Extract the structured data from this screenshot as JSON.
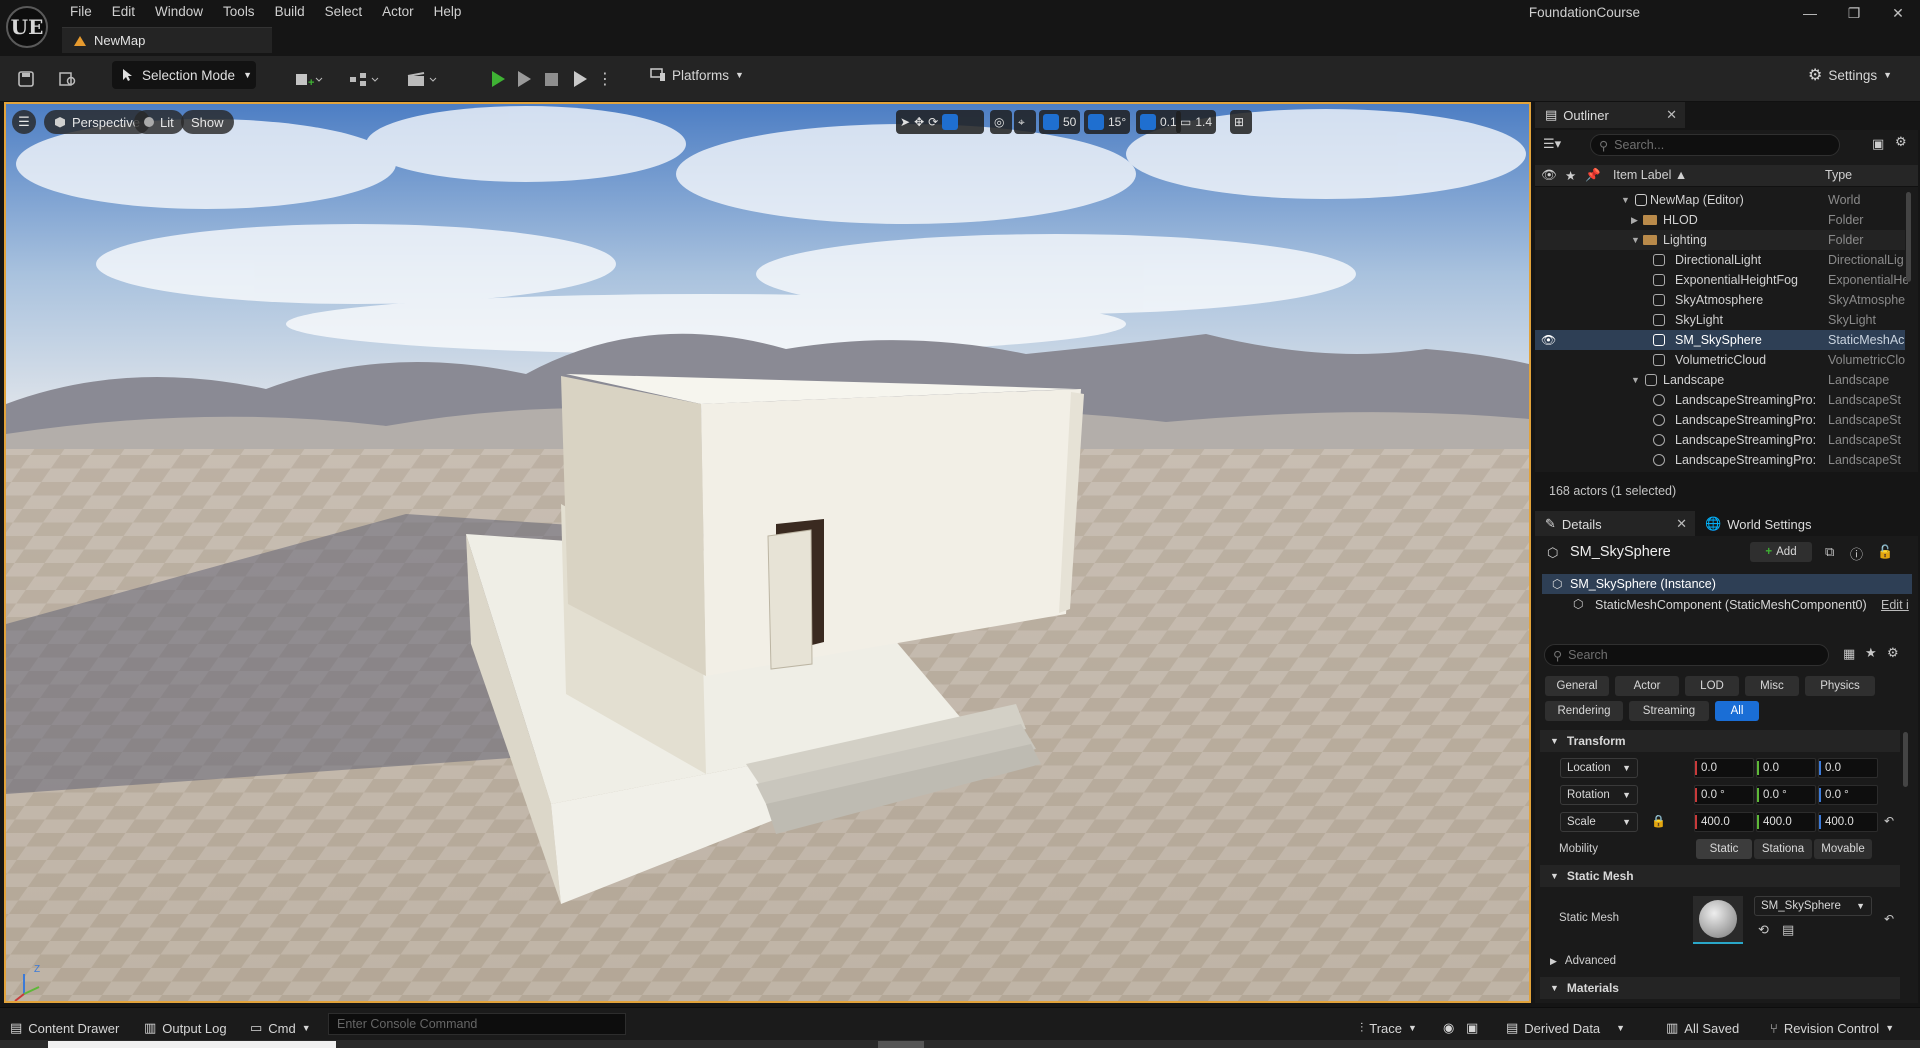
{
  "titlebar": {
    "logo": "UE",
    "menu": [
      "File",
      "Edit",
      "Window",
      "Tools",
      "Build",
      "Select",
      "Actor",
      "Help"
    ],
    "project": "FoundationCourse",
    "tab": "NewMap"
  },
  "toolbar": {
    "selection_mode": "Selection Mode",
    "platforms": "Platforms",
    "settings": "Settings"
  },
  "viewport": {
    "view_mode": "Perspective",
    "lighting": "Lit",
    "show": "Show",
    "grid_snap": "50",
    "rot_snap": "15°",
    "scale_snap": "0.1",
    "cam_speed": "1.4",
    "axis_label": "Z"
  },
  "outliner": {
    "title": "Outliner",
    "search_placeholder": "Search...",
    "col_label": "Item Label ▲",
    "col_type": "Type",
    "rows": [
      {
        "label": "NewMap (Editor)",
        "type": "World"
      },
      {
        "label": "HLOD",
        "type": "Folder"
      },
      {
        "label": "Lighting",
        "type": "Folder"
      },
      {
        "label": "DirectionalLight",
        "type": "DirectionalLig"
      },
      {
        "label": "ExponentialHeightFog",
        "type": "ExponentialHe"
      },
      {
        "label": "SkyAtmosphere",
        "type": "SkyAtmosphe"
      },
      {
        "label": "SkyLight",
        "type": "SkyLight"
      },
      {
        "label": "SM_SkySphere",
        "type": "StaticMeshAc"
      },
      {
        "label": "VolumetricCloud",
        "type": "VolumetricClo"
      },
      {
        "label": "Landscape",
        "type": "Landscape"
      },
      {
        "label": "LandscapeStreamingPro:",
        "type": "LandscapeSt"
      },
      {
        "label": "LandscapeStreamingPro:",
        "type": "LandscapeSt"
      },
      {
        "label": "LandscapeStreamingPro:",
        "type": "LandscapeSt"
      },
      {
        "label": "LandscapeStreamingPro:",
        "type": "LandscapeSt"
      }
    ],
    "footer": "168 actors (1 selected)"
  },
  "details": {
    "tab": "Details",
    "tab2": "World Settings",
    "actor": "SM_SkySphere",
    "add": "Add",
    "instance": "SM_SkySphere (Instance)",
    "component": "StaticMeshComponent (StaticMeshComponent0)",
    "edit": "Edit i",
    "search_placeholder": "Search",
    "filters_row1": [
      "General",
      "Actor",
      "LOD",
      "Misc",
      "Physics"
    ],
    "filters_row2": [
      "Rendering",
      "Streaming",
      "All"
    ],
    "transform": "Transform",
    "location": {
      "label": "Location",
      "x": "0.0",
      "y": "0.0",
      "z": "0.0"
    },
    "rotation": {
      "label": "Rotation",
      "x": "0.0 °",
      "y": "0.0 °",
      "z": "0.0 °"
    },
    "scale": {
      "label": "Scale",
      "x": "400.0",
      "y": "400.0",
      "z": "400.0"
    },
    "mobility": {
      "label": "Mobility",
      "options": [
        "Static",
        "Stationa",
        "Movable"
      ]
    },
    "static_mesh_section": "Static Mesh",
    "static_mesh_label": "Static Mesh",
    "static_mesh_value": "SM_SkySphere",
    "advanced": "Advanced",
    "materials": "Materials"
  },
  "statusbar": {
    "content_drawer": "Content Drawer",
    "output_log": "Output Log",
    "cmd": "Cmd",
    "console_placeholder": "Enter Console Command",
    "trace": "Trace",
    "derived_data": "Derived Data",
    "all_saved": "All Saved",
    "revision_control": "Revision Control"
  }
}
